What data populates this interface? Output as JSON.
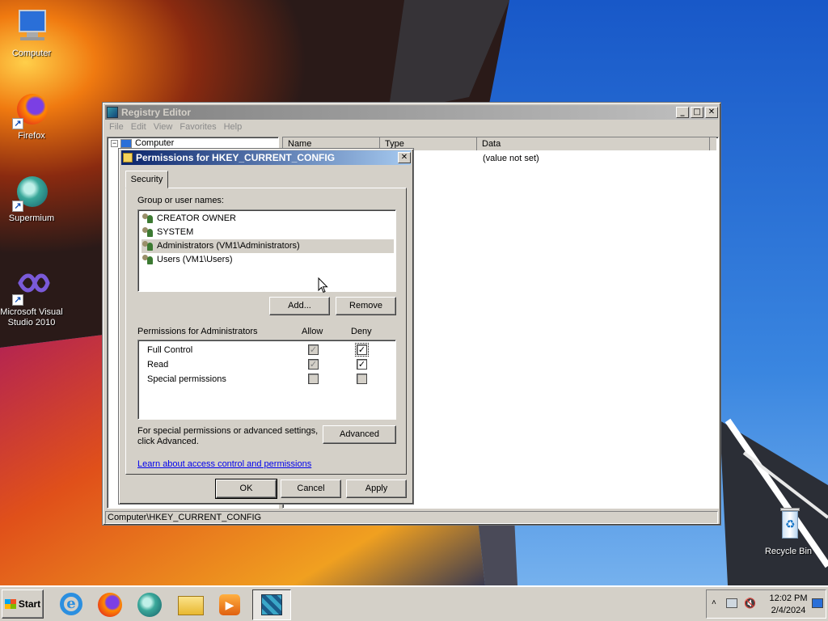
{
  "desktop": {
    "icons": [
      {
        "label": "Computer"
      },
      {
        "label": "Firefox"
      },
      {
        "label": "Supermium"
      },
      {
        "label": "Microsoft Visual Studio 2010"
      },
      {
        "label": "Recycle Bin"
      }
    ]
  },
  "registry": {
    "title": "Registry Editor",
    "menu": [
      "File",
      "Edit",
      "View",
      "Favorites",
      "Help"
    ],
    "tree_root": "Computer",
    "columns": [
      "Name",
      "Type",
      "Data"
    ],
    "row_data": "(value not set)",
    "status_path": "Computer\\HKEY_CURRENT_CONFIG"
  },
  "permissions": {
    "title": "Permissions for HKEY_CURRENT_CONFIG",
    "tab": "Security",
    "group_label": "Group or user names:",
    "users": [
      "CREATOR OWNER",
      "SYSTEM",
      "Administrators (VM1\\Administrators)",
      "Users (VM1\\Users)"
    ],
    "selected_user_index": 2,
    "add_label": "Add...",
    "remove_label": "Remove",
    "perm_label": "Permissions for Administrators",
    "allow_label": "Allow",
    "deny_label": "Deny",
    "perms": [
      {
        "name": "Full Control",
        "allow": true,
        "allow_disabled": true,
        "deny": true
      },
      {
        "name": "Read",
        "allow": true,
        "allow_disabled": true,
        "deny": true
      },
      {
        "name": "Special permissions",
        "allow": false,
        "allow_disabled": true,
        "deny": false
      }
    ],
    "special_text_1": "For special permissions or advanced settings,",
    "special_text_2": "click Advanced.",
    "advanced_label": "Advanced",
    "learn_link": "Learn about access control and permissions",
    "ok_label": "OK",
    "cancel_label": "Cancel",
    "apply_label": "Apply"
  },
  "taskbar": {
    "start_label": "Start",
    "time": "12:02 PM",
    "date": "2/4/2024"
  },
  "colors": {
    "title_active": "#0a246a",
    "title_inactive": "#808080",
    "link": "#0000ee"
  }
}
